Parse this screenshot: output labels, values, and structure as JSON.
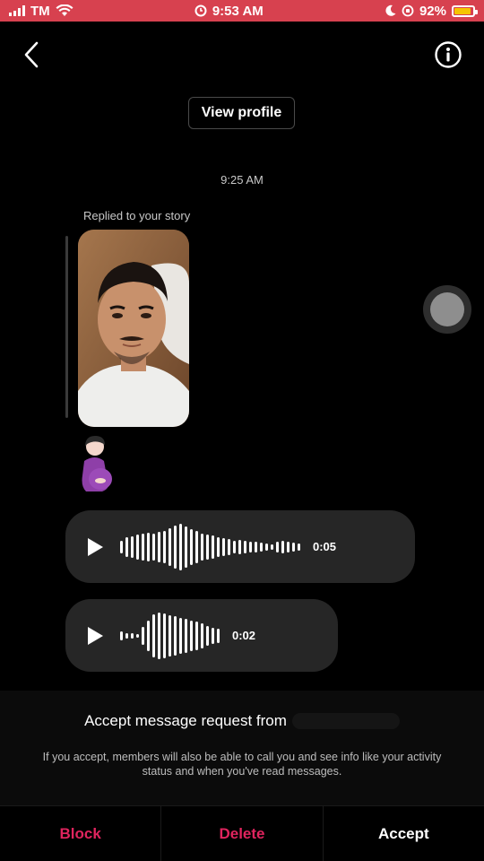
{
  "status_bar": {
    "carrier": "TM",
    "time": "9:53 AM",
    "battery": "92%",
    "battery_level": 0.92,
    "background": "#d7414f"
  },
  "header": {
    "back_icon": "chevron-left-icon",
    "info_icon": "info-circle-icon",
    "view_profile_label": "View profile"
  },
  "conversation": {
    "timestamp": "9:25 AM",
    "story_reply_label": "Replied to your story",
    "emoji_message": "pregnant-woman-emoji",
    "voice_messages": [
      {
        "duration": "0:05"
      },
      {
        "duration": "0:02"
      }
    ]
  },
  "request": {
    "title": "Accept message request from",
    "description": "If you accept, members will also be able to call you and see info like your activity status and when you've read messages.",
    "block_label": "Block",
    "delete_label": "Delete",
    "accept_label": "Accept",
    "danger_color": "#e0245e",
    "accept_color": "#ffffff"
  }
}
